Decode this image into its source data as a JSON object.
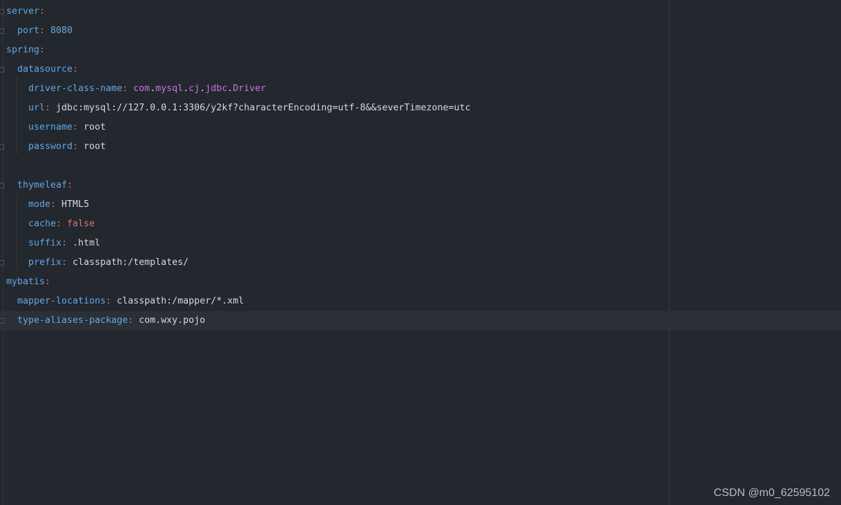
{
  "editor": {
    "lines": [
      {
        "key": "server",
        "sep": ":",
        "value": ""
      },
      {
        "key": "port",
        "sep": ": ",
        "value": "8080"
      },
      {
        "key": "spring",
        "sep": ":",
        "value": ""
      },
      {
        "key": "datasource",
        "sep": ":",
        "value": ""
      },
      {
        "key": "driver-class-name",
        "sep": ": ",
        "value_parts": [
          "com",
          ".",
          "mysql",
          ".",
          "cj",
          ".",
          "jdbc",
          ".",
          "Driver"
        ]
      },
      {
        "key": "url",
        "sep": ": ",
        "value": "jdbc:mysql://127.0.0.1:3306/y2kf?characterEncoding=utf-8&&severTimezone=utc"
      },
      {
        "key": "username",
        "sep": ": ",
        "value": "root"
      },
      {
        "key": "password",
        "sep": ": ",
        "value": "root"
      },
      {
        "key": "",
        "sep": "",
        "value": ""
      },
      {
        "key": "thymeleaf",
        "sep": ":",
        "value": ""
      },
      {
        "key": "mode",
        "sep": ": ",
        "value": "HTML5"
      },
      {
        "key": "cache",
        "sep": ": ",
        "value": "false"
      },
      {
        "key": "suffix",
        "sep": ": ",
        "value": ".html"
      },
      {
        "key": "prefix",
        "sep": ": ",
        "value": "classpath:/templates/"
      },
      {
        "key": "mybatis",
        "sep": ":",
        "value": ""
      },
      {
        "key": "mapper-locations",
        "sep": ": ",
        "value": "classpath:/mapper/*.xml"
      },
      {
        "key": "type-aliases-package",
        "sep": ": ",
        "value": "com.wxy.pojo"
      }
    ]
  },
  "watermark": "CSDN @m0_62595102",
  "colors": {
    "background": "#23272e",
    "key": "#62a8e6",
    "punctuation": "#e06c75",
    "number": "#6fa8dc",
    "package": "#c678dd",
    "boolean": "#e36c77",
    "text": "#d6d9de"
  }
}
